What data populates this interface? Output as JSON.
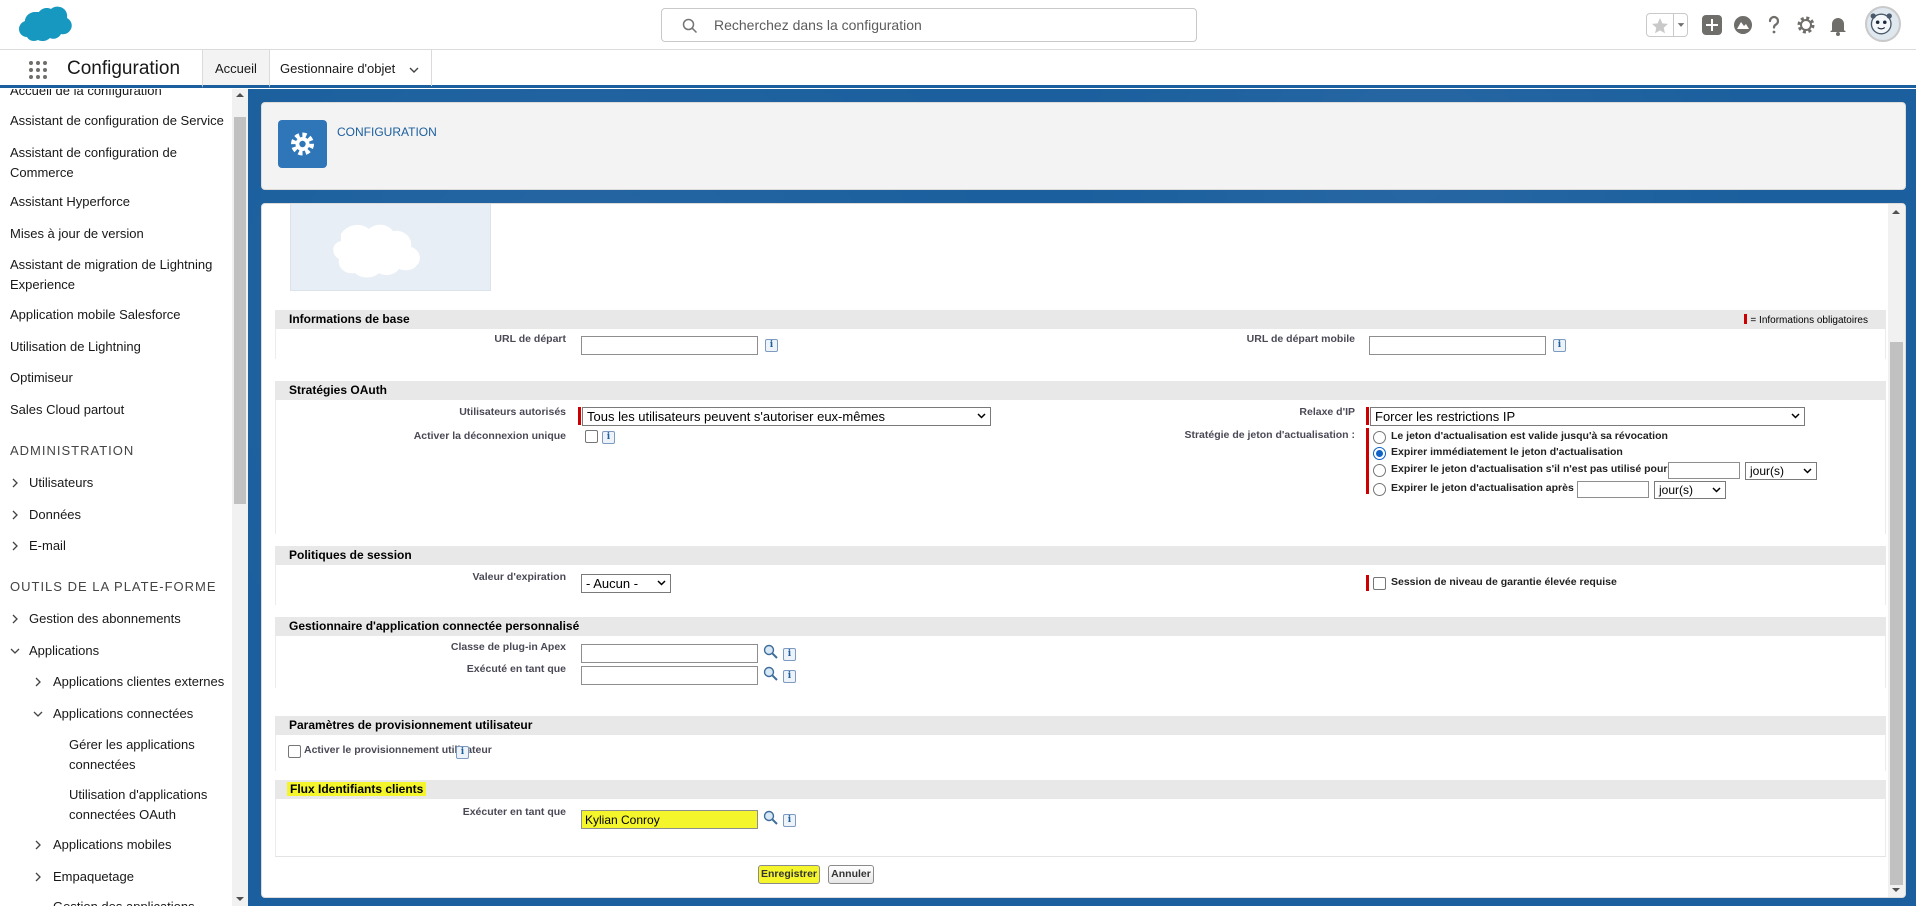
{
  "header": {
    "search_placeholder": "Recherchez dans la configuration",
    "icons": [
      "salesforce-logo",
      "search-icon",
      "favorites-star-icon",
      "chevron-down-icon",
      "global-actions-plus-icon",
      "trailhead-icon",
      "help-icon",
      "setup-gear-icon",
      "notification-bell-icon",
      "user-avatar"
    ]
  },
  "context_bar": {
    "app_name": "Configuration",
    "tabs": [
      {
        "label": "Accueil",
        "active": true
      },
      {
        "label": "Gestionnaire d'objet",
        "active": false
      }
    ]
  },
  "sidebar": {
    "items": [
      {
        "label": "Accueil de la configuration"
      },
      {
        "label": "Assistant de configuration de Service"
      },
      {
        "label": "Assistant de configuration de Commerce"
      },
      {
        "label": "Assistant Hyperforce"
      },
      {
        "label": "Mises à jour de version"
      },
      {
        "label": "Assistant de migration de Lightning Experience"
      },
      {
        "label": "Application mobile Salesforce"
      },
      {
        "label": "Utilisation de Lightning"
      },
      {
        "label": "Optimiseur"
      },
      {
        "label": "Sales Cloud partout"
      }
    ],
    "section_admin": "ADMINISTRATION",
    "admin_items": [
      {
        "label": "Utilisateurs"
      },
      {
        "label": "Données"
      },
      {
        "label": "E-mail"
      }
    ],
    "section_tools": "OUTILS DE LA PLATE-FORME",
    "tools_items": {
      "subscriptions": "Gestion des abonnements",
      "apps": "Applications",
      "external_client_apps": "Applications clientes externes",
      "connected_apps": "Applications connectées",
      "manage_connected_apps": "Gérer les applications connectées",
      "oauth_usage": "Utilisation d'applications connectées OAuth",
      "mobile_apps": "Applications mobiles",
      "packaging": "Empaquetage",
      "cut_off": "Gestion des applications"
    }
  },
  "page_header": {
    "title": "CONFIGURATION"
  },
  "form": {
    "required_note": "= Informations obligatoires",
    "basic_info": {
      "title": "Informations de base",
      "start_url_label": "URL de départ",
      "mobile_start_url_label": "URL de départ mobile",
      "start_url_value": "",
      "mobile_start_url_value": ""
    },
    "oauth_policies": {
      "title": "Stratégies OAuth",
      "permitted_users_label": "Utilisateurs autorisés",
      "permitted_users_value": "Tous les utilisateurs peuvent s'autoriser eux-mêmes",
      "single_logout_label": "Activer la déconnexion unique",
      "ip_relax_label": "Relaxe d'IP",
      "ip_relax_value": "Forcer les restrictions IP",
      "refresh_policy_label": "Stratégie de jeton d'actualisation :",
      "refresh_options": [
        {
          "label": "Le jeton d'actualisation est valide jusqu'à sa révocation",
          "selected": false
        },
        {
          "label": "Expirer immédiatement le jeton d'actualisation",
          "selected": true
        },
        {
          "label": "Expirer le jeton d'actualisation s'il n'est pas utilisé pour",
          "selected": false
        },
        {
          "label": "Expirer le jeton d'actualisation après",
          "selected": false
        }
      ],
      "unit_option": "jour(s)"
    },
    "session_policies": {
      "title": "Politiques de session",
      "timeout_label": "Valeur d'expiration",
      "timeout_value": "- Aucun -",
      "high_assurance_label": "Session de niveau de garantie élevée requise"
    },
    "custom_handler": {
      "title": "Gestionnaire d'application connectée personnalisé",
      "apex_class_label": "Classe de plug-in Apex",
      "run_as_label": "Exécuté en tant que",
      "apex_class_value": "",
      "run_as_value": ""
    },
    "provisioning": {
      "title": "Paramètres de provisionnement utilisateur",
      "enable_label": "Activer le provisionnement utilisateur"
    },
    "client_credentials": {
      "title": "Flux Identifiants clients",
      "run_as_label": "Exécuter en tant que",
      "run_as_value": "Kylian Conroy"
    },
    "buttons": {
      "save": "Enregistrer",
      "cancel": "Annuler"
    }
  },
  "colors": {
    "brand_blue": "#1b5f9e",
    "highlight": "#f4f52a",
    "required_red": "#c00"
  }
}
